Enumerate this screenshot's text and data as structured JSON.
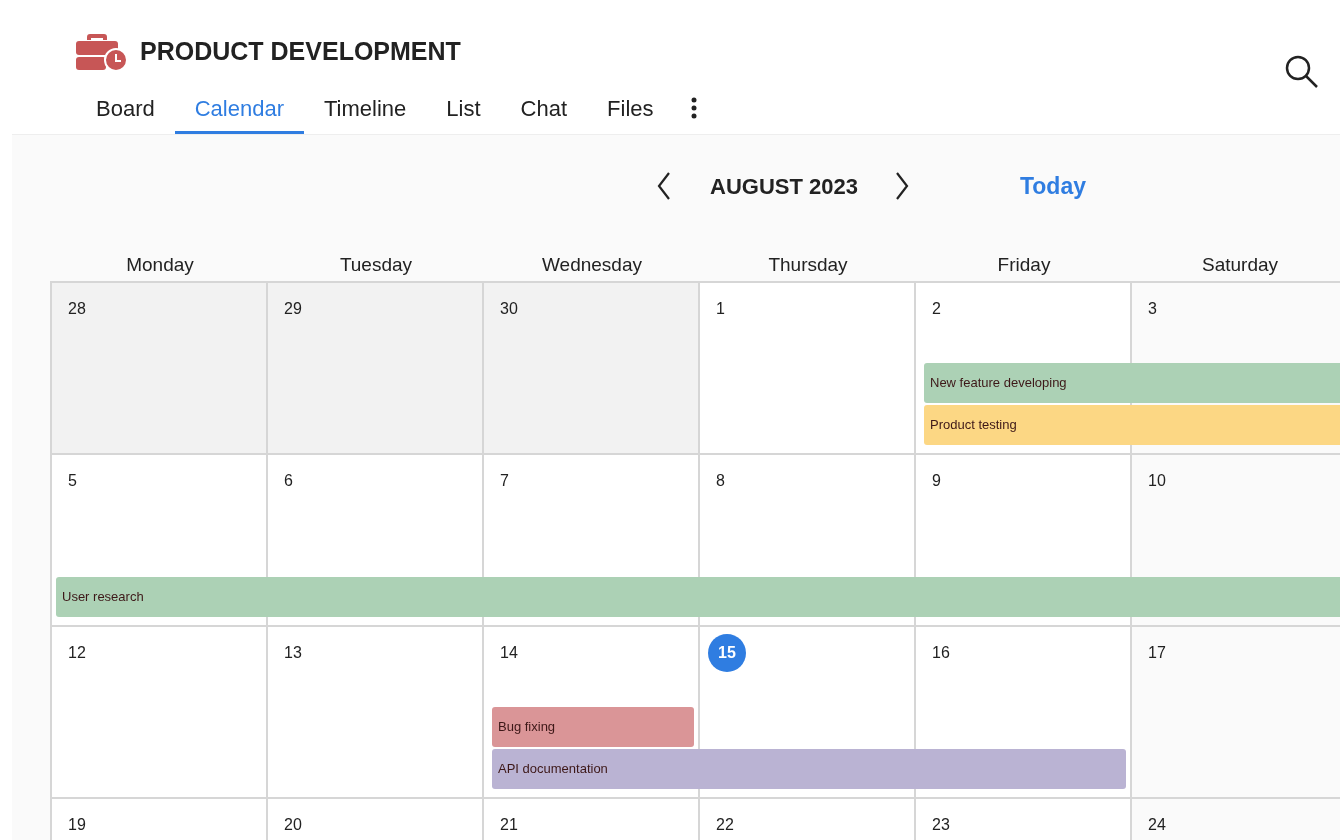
{
  "project": {
    "title": "PRODUCT DEVELOPMENT"
  },
  "tabs": [
    {
      "label": "Board",
      "selected": false
    },
    {
      "label": "Calendar",
      "selected": true
    },
    {
      "label": "Timeline",
      "selected": false
    },
    {
      "label": "List",
      "selected": false
    },
    {
      "label": "Chat",
      "selected": false
    },
    {
      "label": "Files",
      "selected": false
    }
  ],
  "nav": {
    "month": "AUGUST 2023",
    "today": "Today"
  },
  "weekdays": [
    "Monday",
    "Tuesday",
    "Wednesday",
    "Thursday",
    "Friday",
    "Saturday"
  ],
  "weeks": [
    {
      "days": [
        {
          "day": "28",
          "kind": "other",
          "today": false
        },
        {
          "day": "29",
          "kind": "other",
          "today": false
        },
        {
          "day": "30",
          "kind": "other",
          "today": false
        },
        {
          "day": "1",
          "kind": "weekday",
          "today": false
        },
        {
          "day": "2",
          "kind": "weekday",
          "today": false
        },
        {
          "day": "3",
          "kind": "weekend",
          "today": false
        }
      ]
    },
    {
      "days": [
        {
          "day": "5",
          "kind": "weekday",
          "today": false
        },
        {
          "day": "6",
          "kind": "weekday",
          "today": false
        },
        {
          "day": "7",
          "kind": "weekday",
          "today": false
        },
        {
          "day": "8",
          "kind": "weekday",
          "today": false
        },
        {
          "day": "9",
          "kind": "weekday",
          "today": false
        },
        {
          "day": "10",
          "kind": "weekend",
          "today": false
        }
      ]
    },
    {
      "days": [
        {
          "day": "12",
          "kind": "weekday",
          "today": false
        },
        {
          "day": "13",
          "kind": "weekday",
          "today": false
        },
        {
          "day": "14",
          "kind": "weekday",
          "today": false
        },
        {
          "day": "15",
          "kind": "weekday",
          "today": true
        },
        {
          "day": "16",
          "kind": "weekday",
          "today": false
        },
        {
          "day": "17",
          "kind": "weekend",
          "today": false
        }
      ]
    },
    {
      "days": [
        {
          "day": "19",
          "kind": "weekday",
          "today": false
        },
        {
          "day": "20",
          "kind": "weekday",
          "today": false
        },
        {
          "day": "21",
          "kind": "weekday",
          "today": false
        },
        {
          "day": "22",
          "kind": "weekday",
          "today": false
        },
        {
          "day": "23",
          "kind": "weekday",
          "today": false
        },
        {
          "day": "24",
          "kind": "weekend",
          "today": false
        }
      ]
    }
  ],
  "events": [
    {
      "title": "New feature developing",
      "color": "#acd1b5"
    },
    {
      "title": "Product testing",
      "color": "#fcd784"
    },
    {
      "title": "User research",
      "color": "#acd1b5"
    },
    {
      "title": "Bug fixing",
      "color": "#da9597"
    },
    {
      "title": "API documentation",
      "color": "#bab3d3"
    }
  ]
}
